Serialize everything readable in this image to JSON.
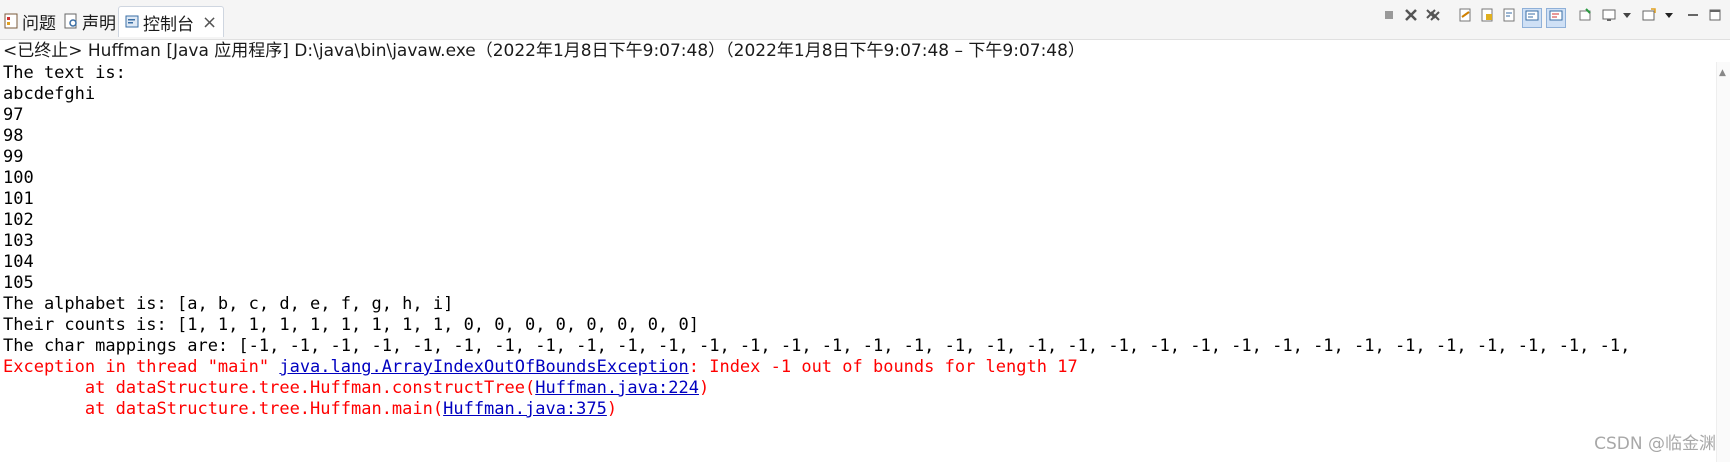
{
  "tabs": [
    {
      "label": "问题",
      "icon": "problems-icon",
      "active": false
    },
    {
      "label": "声明",
      "icon": "declaration-icon",
      "active": false
    },
    {
      "label": "控制台",
      "icon": "console-icon",
      "active": true,
      "close": "×"
    }
  ],
  "toolbar_icons": [
    "stop-icon",
    "remove-launch-icon",
    "remove-all-icon",
    "clear-console-icon",
    "scroll-lock-icon",
    "word-wrap-icon",
    "show-stdout-icon",
    "show-stderr-icon",
    "pin-console-icon",
    "display-console-icon",
    "display-console-dropdown-icon",
    "open-console-icon",
    "open-console-dropdown-icon",
    "minimize-icon",
    "maximize-icon"
  ],
  "status": "<已终止> Huffman [Java 应用程序] D:\\java\\bin\\javaw.exe（2022年1月8日下午9:07:48）（2022年1月8日下午9:07:48 – 下午9:07:48）",
  "console": {
    "output_lines": [
      "The text is:",
      "abcdefghi",
      "97",
      "98",
      "99",
      "100",
      "101",
      "102",
      "103",
      "104",
      "105",
      "The alphabet is: [a, b, c, d, e, f, g, h, i]",
      "Their counts is: [1, 1, 1, 1, 1, 1, 1, 1, 1, 0, 0, 0, 0, 0, 0, 0, 0]",
      "The char mappings are: [-1, -1, -1, -1, -1, -1, -1, -1, -1, -1, -1, -1, -1, -1, -1, -1, -1, -1, -1, -1, -1, -1, -1, -1, -1, -1, -1, -1, -1, -1, -1, -1, -1, -1,"
    ],
    "exception": {
      "prefix": "Exception in thread \"main\" ",
      "class_link": "java.lang.ArrayIndexOutOfBoundsException",
      "message": ": Index -1 out of bounds for length 17"
    },
    "stack": [
      {
        "prefix": "        at dataStructure.tree.Huffman.constructTree(",
        "link": "Huffman.java:224",
        "suffix": ")"
      },
      {
        "prefix": "        at dataStructure.tree.Huffman.main(",
        "link": "Huffman.java:375",
        "suffix": ")"
      }
    ]
  },
  "watermark": "CSDN @临金渊"
}
